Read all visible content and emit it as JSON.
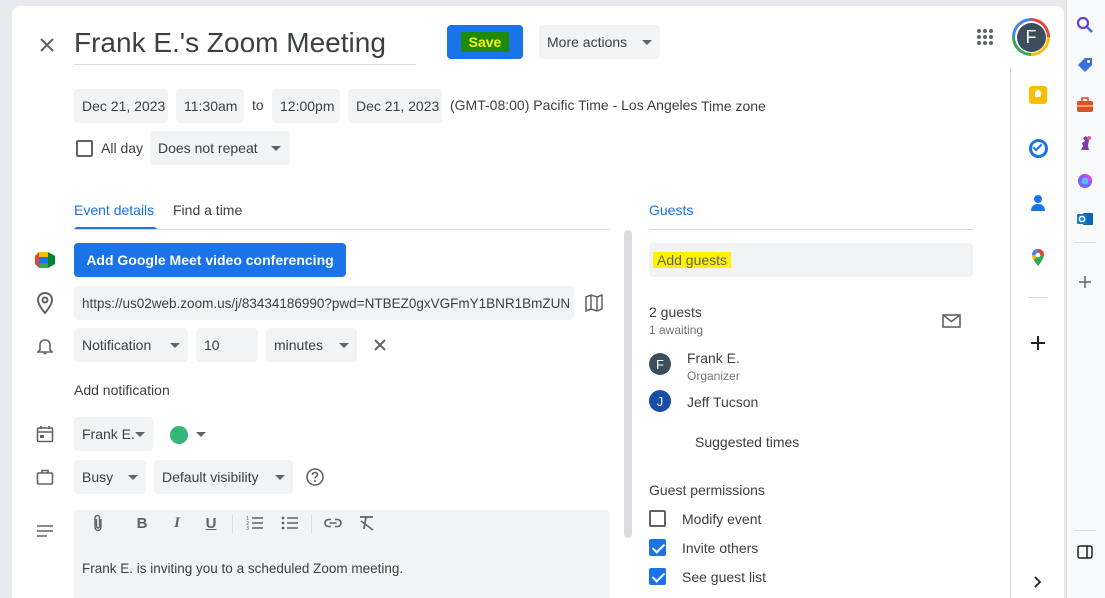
{
  "header": {
    "title": "Frank E.'s Zoom Meeting",
    "save_label": "Save",
    "more_actions_label": "More actions",
    "avatar_letter": "F"
  },
  "datetime": {
    "start_date": "Dec 21, 2023",
    "start_time": "11:30am",
    "to_label": "to",
    "end_time": "12:00pm",
    "end_date": "Dec 21, 2023",
    "timezone_text": "(GMT-08:00) Pacific Time - Los Angeles",
    "timezone_button": "Time zone",
    "all_day_label": "All day",
    "repeat_value": "Does not repeat"
  },
  "tabs": {
    "event_details": "Event details",
    "find_time": "Find a time",
    "guests": "Guests"
  },
  "details": {
    "meet_button": "Add Google Meet video conferencing",
    "location_value": "https://us02web.zoom.us/j/83434186990?pwd=NTBEZ0gxVGFmY1BNR1BmZUN",
    "notification_type": "Notification",
    "notification_amount": "10",
    "notification_unit": "minutes",
    "add_notification": "Add notification",
    "calendar_owner": "Frank E.",
    "busy_status": "Busy",
    "visibility": "Default visibility",
    "description_text": "Frank E. is inviting you to a scheduled Zoom meeting."
  },
  "guests": {
    "add_placeholder": "Add guests",
    "count": "2 guests",
    "awaiting": "1 awaiting",
    "list": [
      {
        "initial": "F",
        "name": "Frank E.",
        "role": "Organizer"
      },
      {
        "initial": "J",
        "name": "Jeff Tucson",
        "role": ""
      }
    ],
    "suggested_times": "Suggested times",
    "permissions_title": "Guest permissions",
    "permissions": [
      {
        "label": "Modify event",
        "checked": false
      },
      {
        "label": "Invite others",
        "checked": true
      },
      {
        "label": "See guest list",
        "checked": true
      }
    ]
  },
  "colors": {
    "accent": "#1a73e8",
    "save_highlight": "#1d8a0c",
    "guest_highlight": "#fff200",
    "calendar_color": "#33b679"
  }
}
